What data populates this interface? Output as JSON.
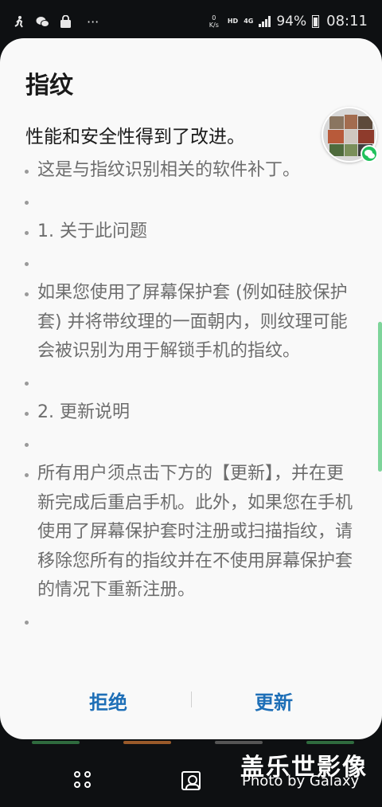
{
  "status_bar": {
    "net_speed_value": "0",
    "net_speed_unit": "K/s",
    "hd_label": "HD",
    "network_label": "4G",
    "battery": "94%",
    "time": "08:11",
    "notification_icons": [
      "person-run-icon",
      "wechat-icon",
      "shopping-bag-icon",
      "more-dots-icon"
    ],
    "more_indicator": "···"
  },
  "dialog": {
    "title": "指纹",
    "subtitle": "性能和安全性得到了改进。",
    "bullets": [
      "这是与指纹识别相关的软件补丁。",
      "",
      "1. 关于此问题",
      "",
      "如果您使用了屏幕保护套 (例如硅胶保护套) 并将带纹理的一面朝内，则纹理可能会被识别为用于解锁手机的指纹。",
      "",
      "2. 更新说明",
      "",
      "所有用户须点击下方的【更新】，并在更新完成后重启手机。此外，如果您在手机使用了屏幕保护套时注册或扫描指纹，请移除您所有的指纹并在不使用屏幕保护套的情况下重新注册。",
      ""
    ],
    "buttons": {
      "reject": "拒绝",
      "update": "更新"
    },
    "accent_color": "#1e6fb7"
  },
  "chat_head": {
    "badge_icon": "wechat-icon"
  },
  "nav_bar": {
    "icons": [
      "recent-apps-icon",
      "home-icon"
    ]
  },
  "watermark": {
    "line1": "盖乐世影像",
    "line2": "Photo by Galaxy"
  }
}
